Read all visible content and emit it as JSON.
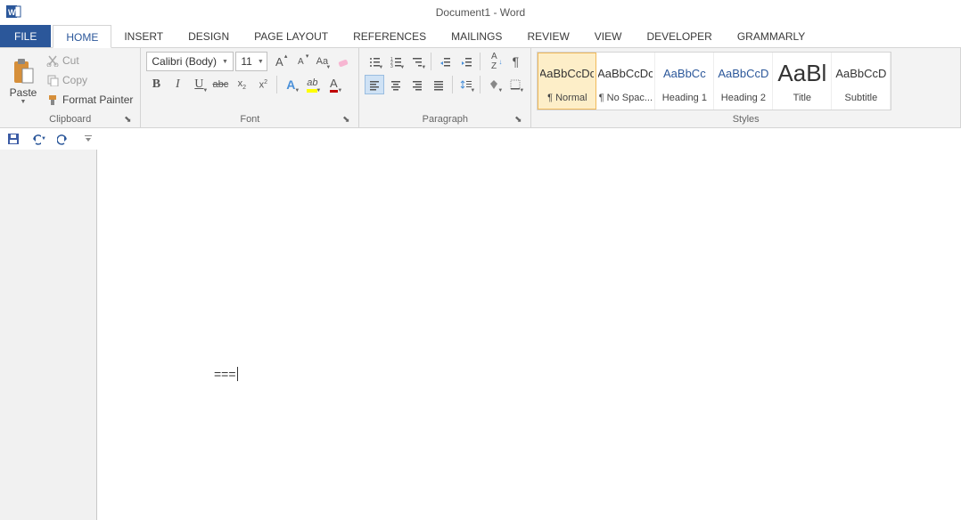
{
  "title": "Document1 - Word",
  "tabs": {
    "file": "FILE",
    "home": "HOME",
    "insert": "INSERT",
    "design": "DESIGN",
    "pagelayout": "PAGE LAYOUT",
    "references": "REFERENCES",
    "mailings": "MAILINGS",
    "review": "REVIEW",
    "view": "VIEW",
    "developer": "DEVELOPER",
    "grammarly": "GRAMMARLY"
  },
  "clipboard": {
    "paste": "Paste",
    "cut": "Cut",
    "copy": "Copy",
    "formatpainter": "Format Painter",
    "group": "Clipboard"
  },
  "font": {
    "name": "Calibri (Body)",
    "size": "11",
    "group": "Font"
  },
  "paragraph": {
    "group": "Paragraph"
  },
  "styles": {
    "group": "Styles",
    "items": [
      {
        "preview": "AaBbCcDc",
        "name": "¶ Normal",
        "accent": false,
        "big": false
      },
      {
        "preview": "AaBbCcDc",
        "name": "¶ No Spac...",
        "accent": false,
        "big": false
      },
      {
        "preview": "AaBbCc",
        "name": "Heading 1",
        "accent": true,
        "big": false
      },
      {
        "preview": "AaBbCcD",
        "name": "Heading 2",
        "accent": true,
        "big": false
      },
      {
        "preview": "AaBl",
        "name": "Title",
        "accent": false,
        "big": true
      },
      {
        "preview": "AaBbCcD",
        "name": "Subtitle",
        "accent": false,
        "big": false
      }
    ]
  },
  "document": {
    "text": "==="
  }
}
